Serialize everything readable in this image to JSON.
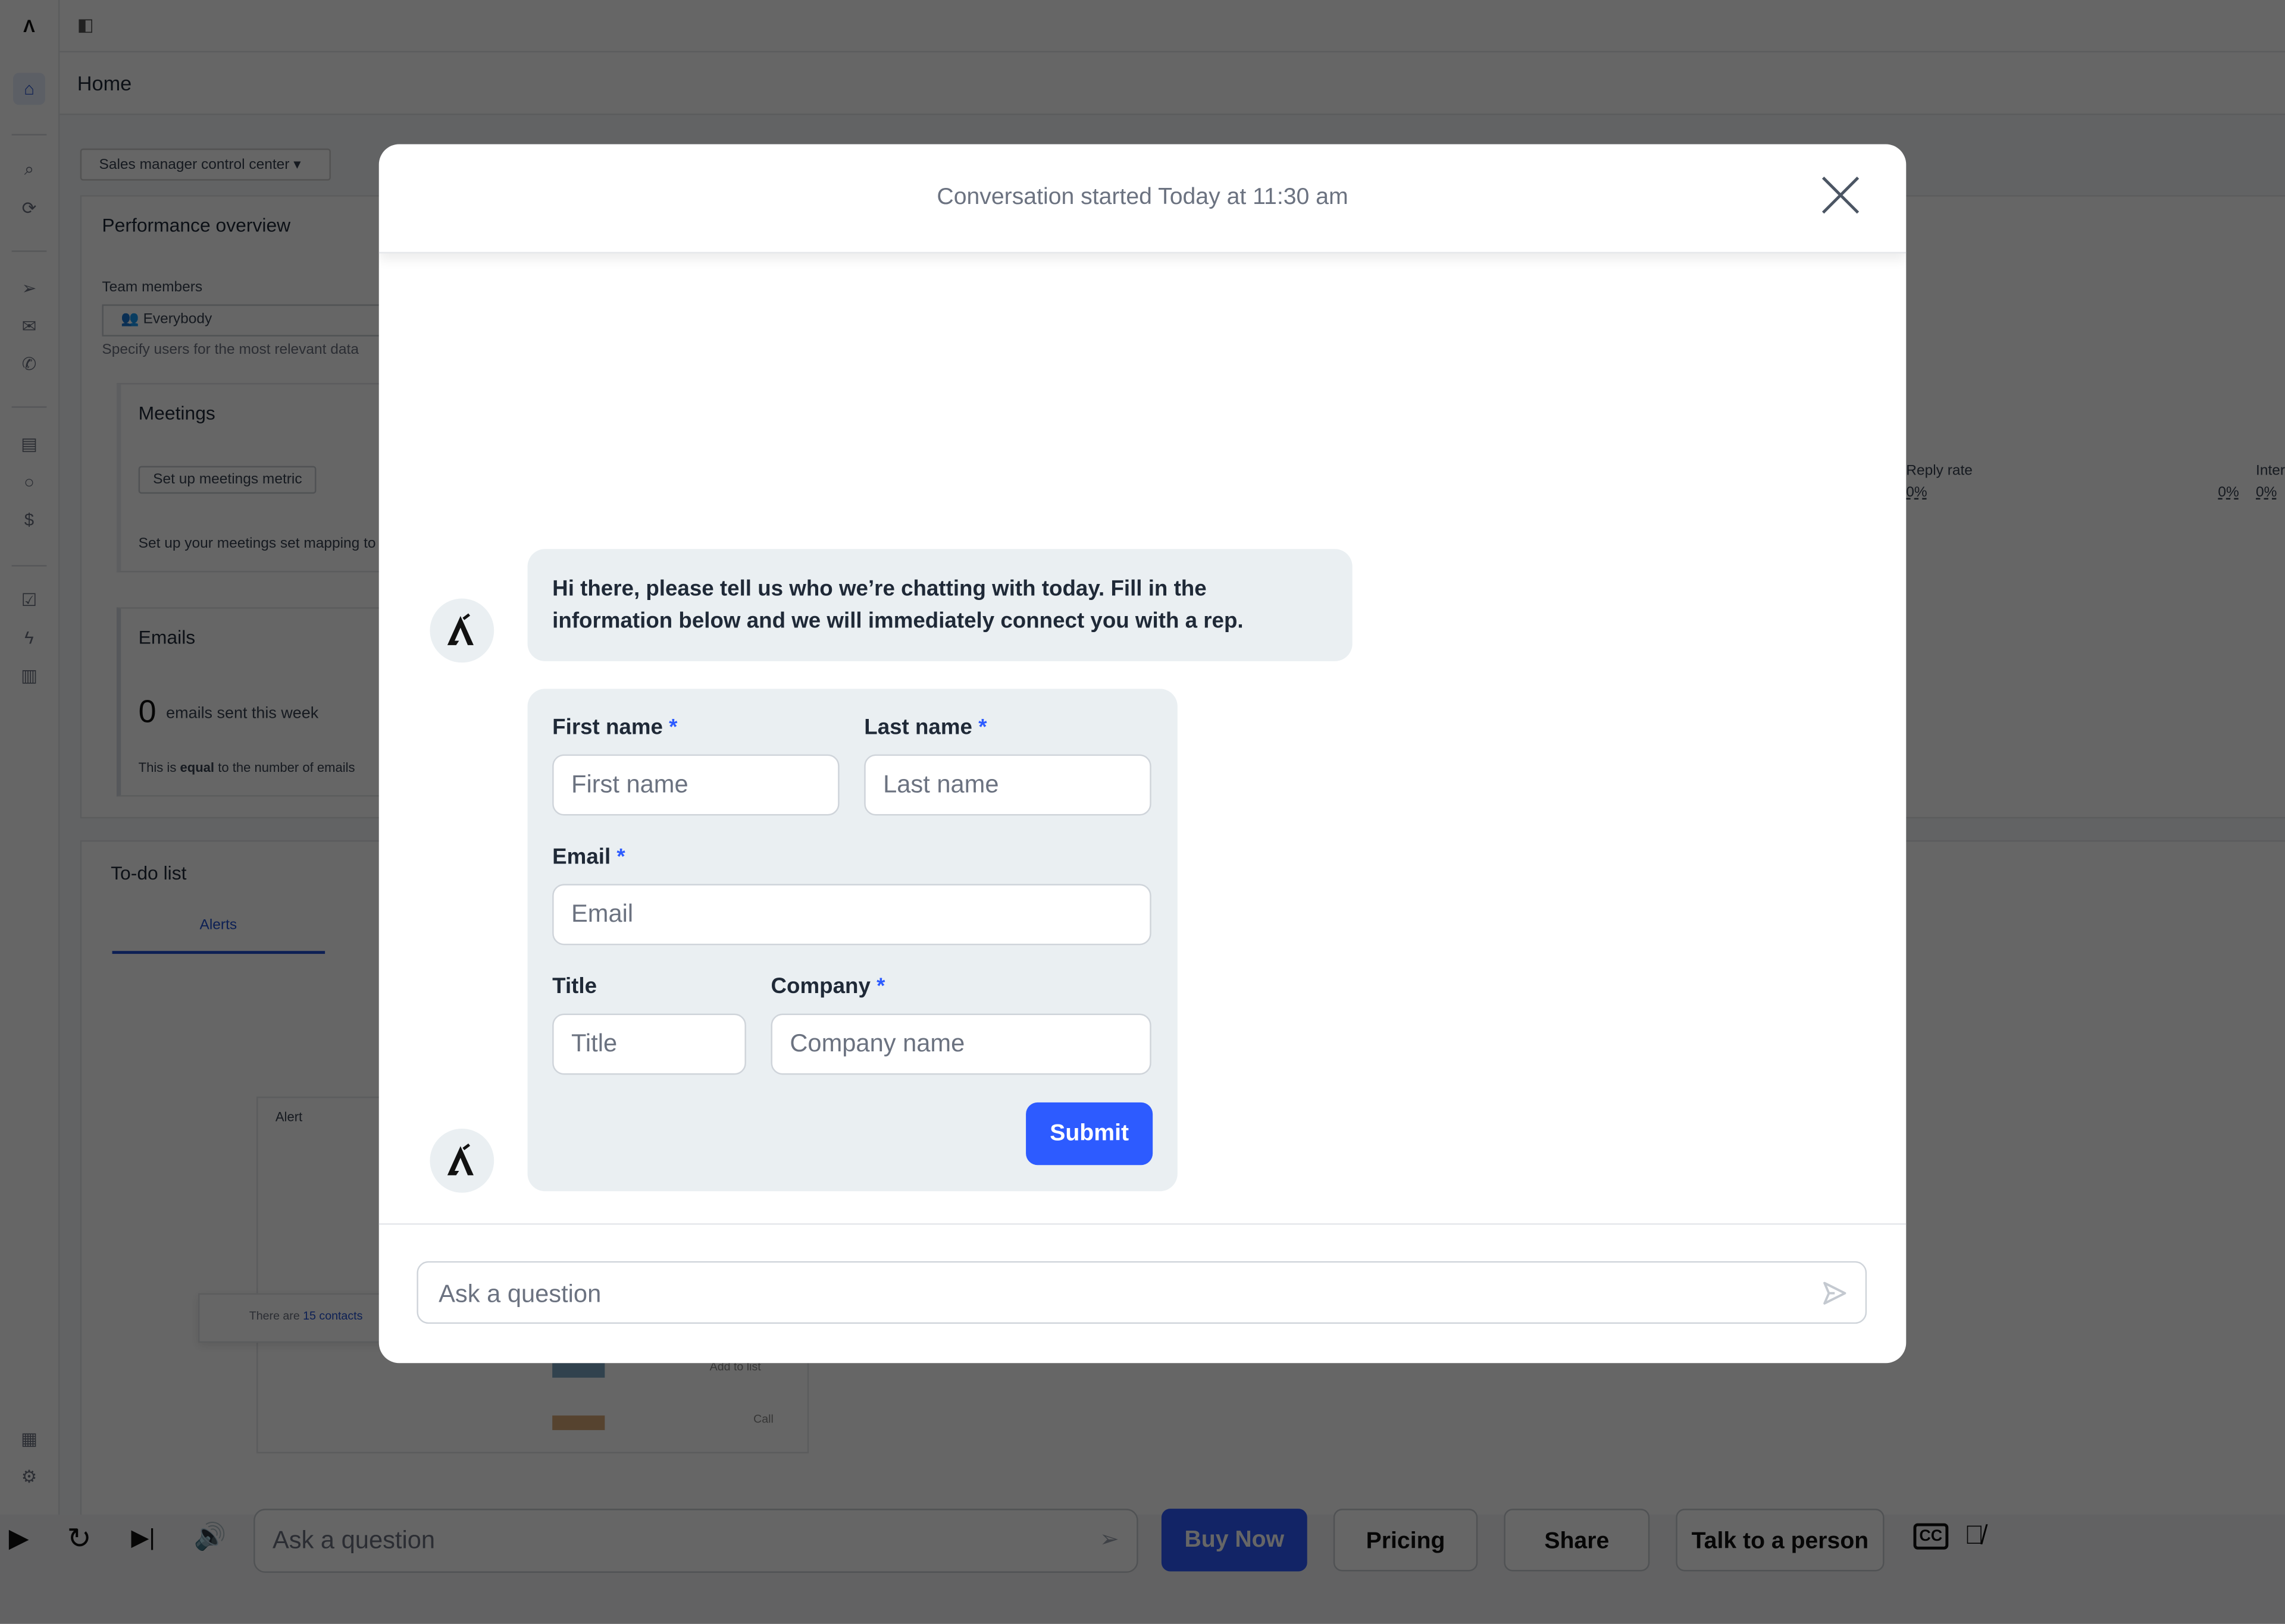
{
  "app": {
    "page_title": "Home",
    "dashboard_select": "Sales manager control center",
    "performance": {
      "title": "Performance overview",
      "team_label": "Team members",
      "team_value": "Everybody",
      "team_hint": "Specify users for the most relevant data",
      "meetings": {
        "title": "Meetings",
        "button": "Set up meetings metric",
        "note": "Set up your meetings set mapping to"
      },
      "emails": {
        "title": "Emails",
        "count": "0",
        "count_label": "emails sent this week",
        "note_pre": "This is ",
        "note_bold": "equal",
        "note_post": " to the number of emails"
      },
      "reply_rate": {
        "label": "Reply rate",
        "value_left": "0%",
        "value_right": "0%"
      },
      "interested": {
        "label": "Inter",
        "value": "0%"
      }
    },
    "todo": {
      "title": "To-do list",
      "tab": "Alerts",
      "alert_header": "Alert",
      "toast_pre": "There are ",
      "toast_link": "15 contacts",
      "add_to_list": "Add to list",
      "call": "Call"
    }
  },
  "player": {
    "ask_placeholder": "Ask a question",
    "buttons": {
      "buy_now": "Buy Now",
      "pricing": "Pricing",
      "share": "Share",
      "talk": "Talk to a person"
    },
    "colors": {
      "buy_now": "#1a3fbf"
    }
  },
  "modal": {
    "header": "Conversation started Today at 11:30 am",
    "message": "Hi there, please tell us who we’re chatting with today. Fill in the information below and we will immediately connect you with a rep.",
    "form": {
      "first_name": {
        "label": "First name",
        "required": "*",
        "placeholder": "First name"
      },
      "last_name": {
        "label": "Last name",
        "required": "*",
        "placeholder": "Last name"
      },
      "email": {
        "label": "Email",
        "required": "*",
        "placeholder": "Email"
      },
      "title": {
        "label": "Title",
        "placeholder": "Title"
      },
      "company": {
        "label": "Company",
        "required": "*",
        "placeholder": "Company name"
      },
      "submit": "Submit"
    },
    "ask_placeholder": "Ask a question",
    "colors": {
      "accent": "#2d5bff",
      "bubble": "#eaeff2"
    }
  }
}
